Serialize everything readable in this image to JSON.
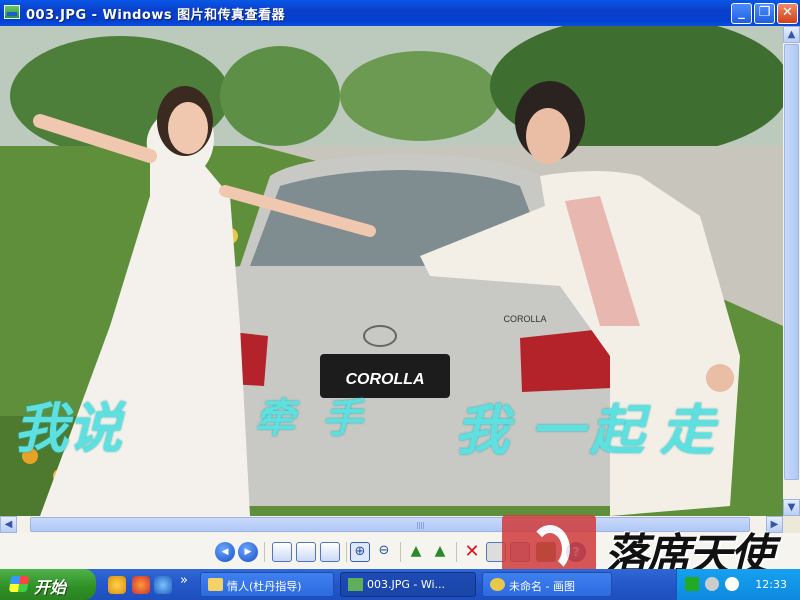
{
  "window": {
    "title": "003.JPG - Windows 图片和传真查看器",
    "buttons": {
      "minimize": "_",
      "restore": "❐",
      "close": "✕"
    }
  },
  "photo": {
    "plate": "COROLLA",
    "badge": "COROLLA",
    "caption": [
      "我说",
      "牵",
      "手",
      "我",
      "一",
      "起",
      "走"
    ],
    "colors": {
      "caption": "#5fe0e0",
      "car": "#c8c8c4",
      "grass": "#5f8f3a"
    }
  },
  "toolbar": {
    "icons": [
      "previous-image-icon",
      "next-image-icon",
      "best-fit-icon",
      "actual-size-icon",
      "slideshow-icon",
      "zoom-in-icon",
      "zoom-out-icon",
      "rotate-clockwise-icon",
      "rotate-counterclockwise-icon",
      "delete-icon",
      "print-icon",
      "save-icon",
      "edit-icon",
      "help-icon"
    ]
  },
  "watermark": {
    "text": "落席天使"
  },
  "taskbar": {
    "start_label": "开始",
    "quick_launch_more": "»",
    "tasks": [
      {
        "label": "情人(杜丹指导)"
      },
      {
        "label": "003.JPG - Wi..."
      },
      {
        "label": "未命名 - 画图"
      }
    ],
    "clock": "12:33"
  }
}
